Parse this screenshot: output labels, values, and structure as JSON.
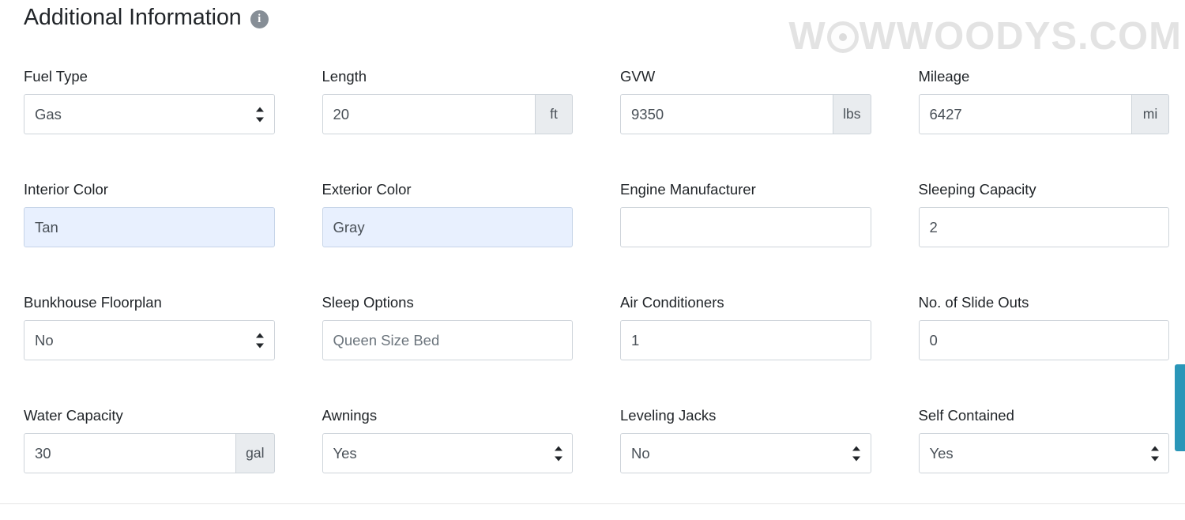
{
  "header": {
    "title": "Additional Information",
    "info_icon": "info-circle-icon",
    "info_icon_glyph": "i"
  },
  "watermark": {
    "text_before": "W",
    "text_after": "WWOODYS.COM",
    "icon": "target-bullseye-icon",
    "color": "#e3e3e3"
  },
  "side_tab": {
    "name": "feedback-side-tab",
    "color": "#2a96b8"
  },
  "fields": [
    {
      "label": "Fuel Type",
      "control": "select",
      "value": "Gas",
      "name": "fuel-type"
    },
    {
      "label": "Length",
      "control": "input",
      "value": "20",
      "unit": "ft",
      "name": "length"
    },
    {
      "label": "GVW",
      "control": "input",
      "value": "9350",
      "unit": "lbs",
      "name": "gvw"
    },
    {
      "label": "Mileage",
      "control": "input",
      "value": "6427",
      "unit": "mi",
      "name": "mileage"
    },
    {
      "label": "Interior Color",
      "control": "input",
      "value": "Tan",
      "style": "autofill",
      "name": "interior-color"
    },
    {
      "label": "Exterior Color",
      "control": "input",
      "value": "Gray",
      "style": "autofill",
      "name": "exterior-color"
    },
    {
      "label": "Engine Manufacturer",
      "control": "input",
      "value": "",
      "name": "engine-manufacturer"
    },
    {
      "label": "Sleeping Capacity",
      "control": "input",
      "value": "2",
      "name": "sleeping-capacity"
    },
    {
      "label": "Bunkhouse Floorplan",
      "control": "select",
      "value": "No",
      "name": "bunkhouse-floorplan"
    },
    {
      "label": "Sleep Options",
      "control": "input",
      "value": "Queen Size Bed",
      "style": "muted",
      "name": "sleep-options"
    },
    {
      "label": "Air Conditioners",
      "control": "input",
      "value": "1",
      "name": "air-conditioners"
    },
    {
      "label": "No. of Slide Outs",
      "control": "input",
      "value": "0",
      "name": "slide-outs"
    },
    {
      "label": "Water Capacity",
      "control": "input",
      "value": "30",
      "unit": "gal",
      "name": "water-capacity"
    },
    {
      "label": "Awnings",
      "control": "select",
      "value": "Yes",
      "name": "awnings"
    },
    {
      "label": "Leveling Jacks",
      "control": "select",
      "value": "No",
      "name": "leveling-jacks"
    },
    {
      "label": "Self Contained",
      "control": "select",
      "value": "Yes",
      "name": "self-contained"
    }
  ]
}
